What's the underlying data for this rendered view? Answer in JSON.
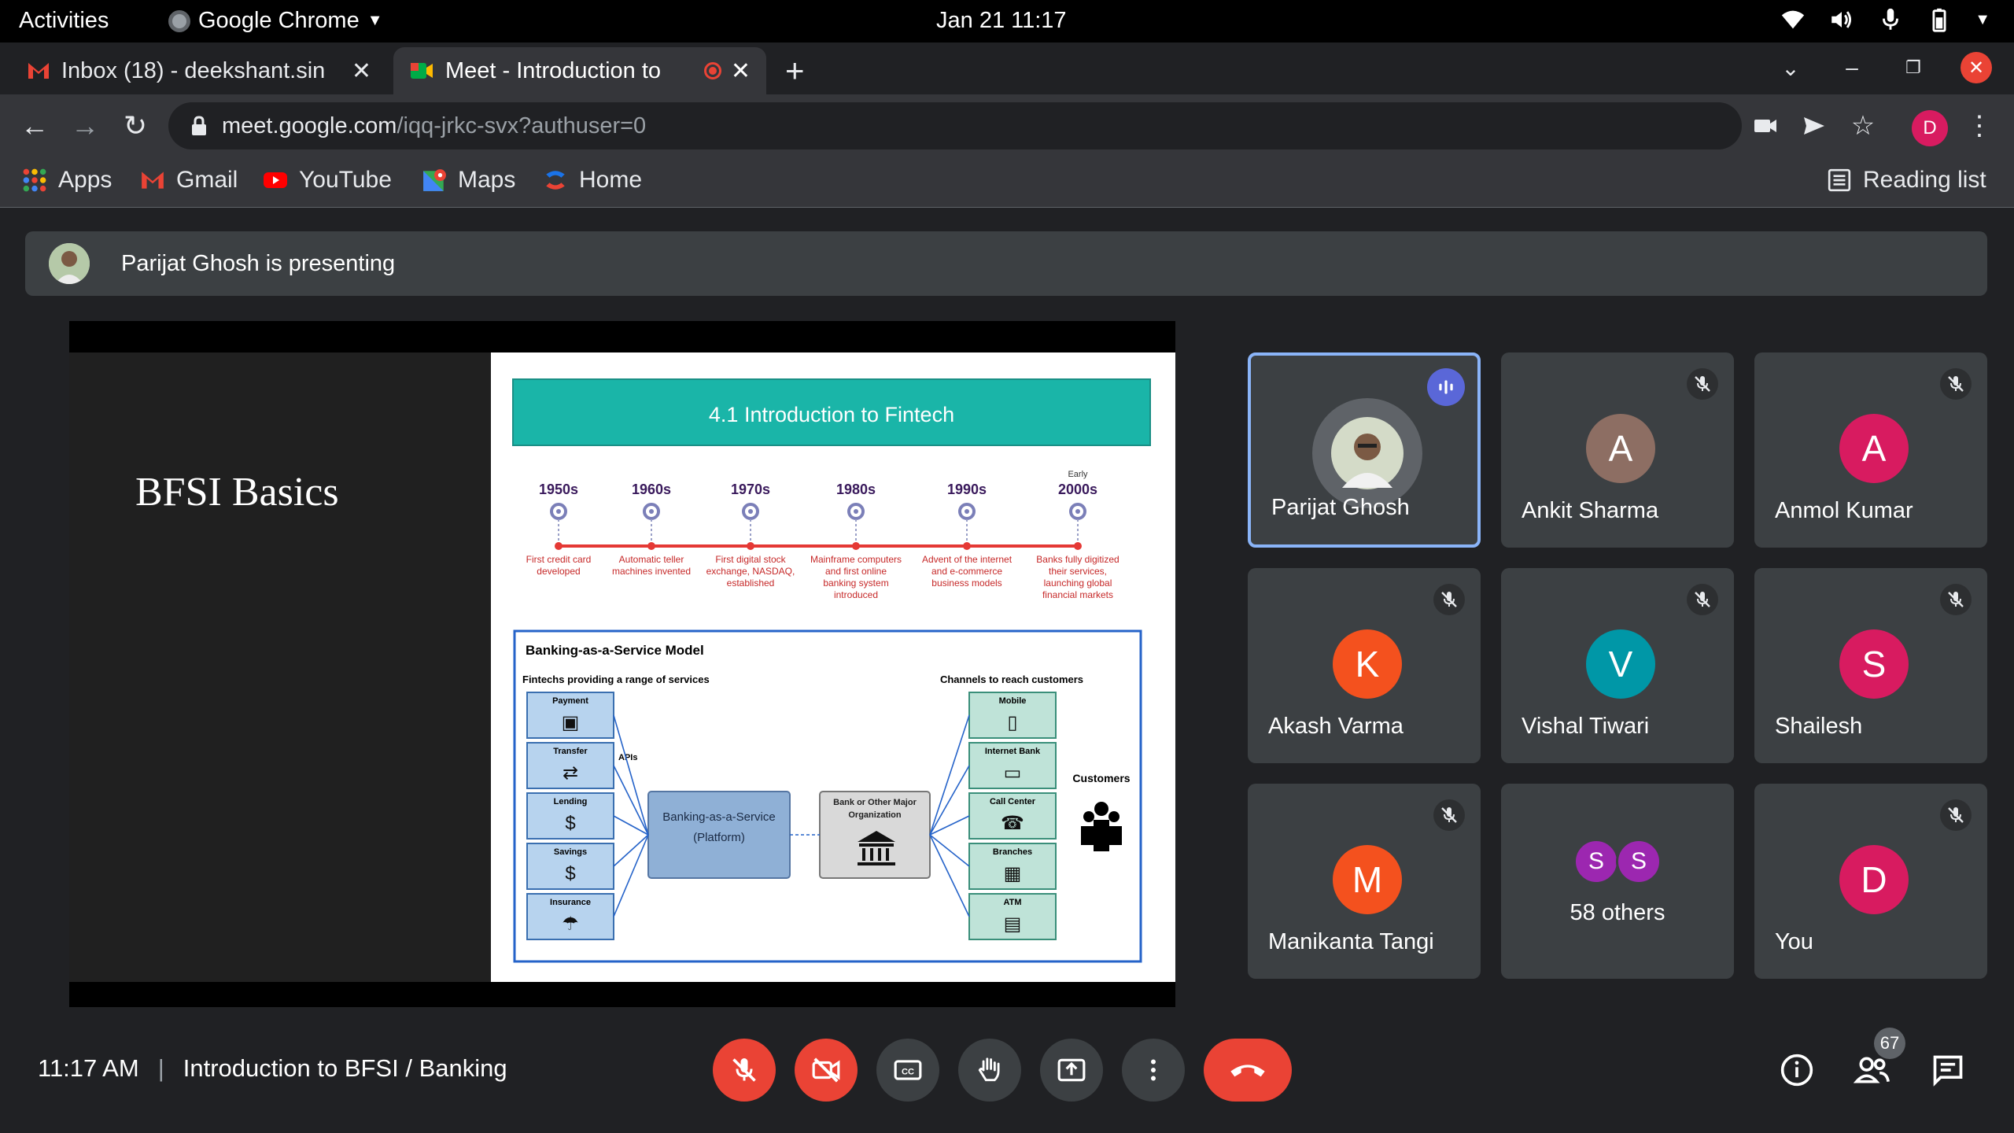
{
  "system_bar": {
    "activities": "Activities",
    "app_name": "Google Chrome",
    "datetime": "Jan 21  11:17"
  },
  "tabs": [
    {
      "title": "Inbox (18) - deekshant.sin",
      "active": false
    },
    {
      "title": "Meet - Introduction to",
      "active": true
    }
  ],
  "address_bar": {
    "host": "meet.google.com",
    "path": "/iqq-jrkc-svx?authuser=0"
  },
  "profile_initial": "D",
  "bookmarks": [
    {
      "label": "Apps",
      "icon": "apps-grid-icon"
    },
    {
      "label": "Gmail",
      "icon": "gmail-icon"
    },
    {
      "label": "YouTube",
      "icon": "youtube-icon"
    },
    {
      "label": "Maps",
      "icon": "maps-icon"
    },
    {
      "label": "Home",
      "icon": "home-icon"
    }
  ],
  "reading_list": "Reading list",
  "presenting_banner": "Parijat Ghosh is presenting",
  "slide": {
    "left_title": "BFSI Basics",
    "header": "4.1 Introduction to Fintech",
    "timeline": [
      {
        "prefix": "",
        "era": "1950s",
        "desc": "First credit card developed"
      },
      {
        "prefix": "",
        "era": "1960s",
        "desc": "Automatic teller machines invented"
      },
      {
        "prefix": "",
        "era": "1970s",
        "desc": "First digital stock exchange, NASDAQ, established"
      },
      {
        "prefix": "",
        "era": "1980s",
        "desc": "Mainframe computers and first online banking system introduced"
      },
      {
        "prefix": "",
        "era": "1990s",
        "desc": "Advent of the internet and e-commerce business models"
      },
      {
        "prefix": "Early",
        "era": "2000s",
        "desc": "Banks fully digitized their services, launching global financial markets"
      }
    ],
    "baas": {
      "title": "Banking-as-a-Service Model",
      "left_heading": "Fintechs providing a range of services",
      "services": [
        "Payment",
        "Transfer",
        "Lending",
        "Savings",
        "Insurance"
      ],
      "apis": "APIs",
      "platform": "Banking-as-a-Service (Platform)",
      "bank": "Bank or Other Major Organization",
      "channels_heading": "Channels to reach customers",
      "channels": [
        "Mobile",
        "Internet Bank",
        "Call Center",
        "Branches",
        "ATM"
      ],
      "customers": "Customers"
    }
  },
  "participants": [
    {
      "name": "Parijat Ghosh",
      "initial": "",
      "color": "#5f6368",
      "speaking": true,
      "muted": false
    },
    {
      "name": "Ankit Sharma",
      "initial": "A",
      "color": "#8d6e63",
      "speaking": false,
      "muted": true
    },
    {
      "name": "Anmol Kumar",
      "initial": "A",
      "color": "#d81b60",
      "speaking": false,
      "muted": true
    },
    {
      "name": "Akash Varma",
      "initial": "K",
      "color": "#f4511e",
      "speaking": false,
      "muted": true
    },
    {
      "name": "Vishal Tiwari",
      "initial": "V",
      "color": "#0097a7",
      "speaking": false,
      "muted": true
    },
    {
      "name": "Shailesh",
      "initial": "S",
      "color": "#d81b60",
      "speaking": false,
      "muted": true
    },
    {
      "name": "Manikanta Tangi",
      "initial": "M",
      "color": "#f4511e",
      "speaking": false,
      "muted": true
    },
    {
      "name": "You",
      "initial": "D",
      "color": "#d81b60",
      "speaking": false,
      "muted": true
    }
  ],
  "others_tile": {
    "initials": [
      "S",
      "S"
    ],
    "label": "58 others"
  },
  "meeting": {
    "time": "11:17 AM",
    "separator": "|",
    "title": "Introduction to BFSI / Banking",
    "people_count": "67"
  }
}
